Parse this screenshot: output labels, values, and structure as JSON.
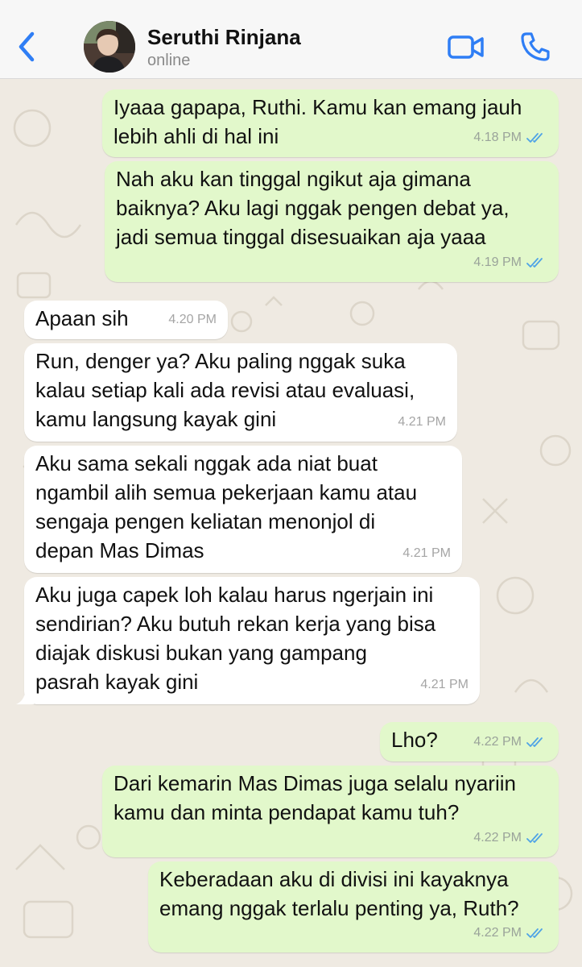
{
  "header": {
    "contact_name": "Seruthi Rinjana",
    "status": "online"
  },
  "colors": {
    "accent": "#2f7ef5",
    "outgoing_bubble": "#e2f8cb",
    "incoming_bubble": "#ffffff",
    "read_ticks": "#4fa3e6",
    "wallpaper": "#efeae2"
  },
  "messages": [
    {
      "direction": "out",
      "text": "Iyaaa gapapa, Ruthi. Kamu kan emang jauh\nlebih ahli di hal ini",
      "time": "4.18 PM",
      "read": true
    },
    {
      "direction": "out",
      "text": "Nah aku kan tinggal ngikut aja gimana\nbaiknya? Aku lagi nggak pengen debat ya,\njadi semua tinggal disesuaikan aja yaaa",
      "time": "4.19 PM",
      "read": true
    },
    {
      "direction": "in",
      "text": "Apaan sih",
      "time": "4.20 PM"
    },
    {
      "direction": "in",
      "text": "Run, denger ya? Aku paling nggak suka\nkalau setiap kali ada revisi atau evaluasi,\nkamu langsung kayak gini",
      "time": "4.21 PM"
    },
    {
      "direction": "in",
      "text": "Aku sama sekali nggak ada niat buat\nngambil alih semua pekerjaan kamu atau\nsengaja pengen keliatan menonjol di\ndepan Mas Dimas",
      "time": "4.21 PM"
    },
    {
      "direction": "in",
      "text": "Aku juga capek loh kalau harus ngerjain ini\nsendirian? Aku butuh rekan kerja yang bisa\ndiajak diskusi bukan yang gampang\npasrah kayak gini",
      "time": "4.21 PM"
    },
    {
      "direction": "out",
      "text": "Lho?",
      "time": "4.22 PM",
      "read": true
    },
    {
      "direction": "out",
      "text": "Dari kemarin Mas Dimas juga selalu nyariin\nkamu dan minta pendapat kamu tuh?",
      "time": "4.22 PM",
      "read": true
    },
    {
      "direction": "out",
      "text": "Keberadaan aku di divisi ini kayaknya\nemang nggak terlalu penting ya, Ruth?",
      "time": "4.22 PM",
      "read": true
    }
  ]
}
